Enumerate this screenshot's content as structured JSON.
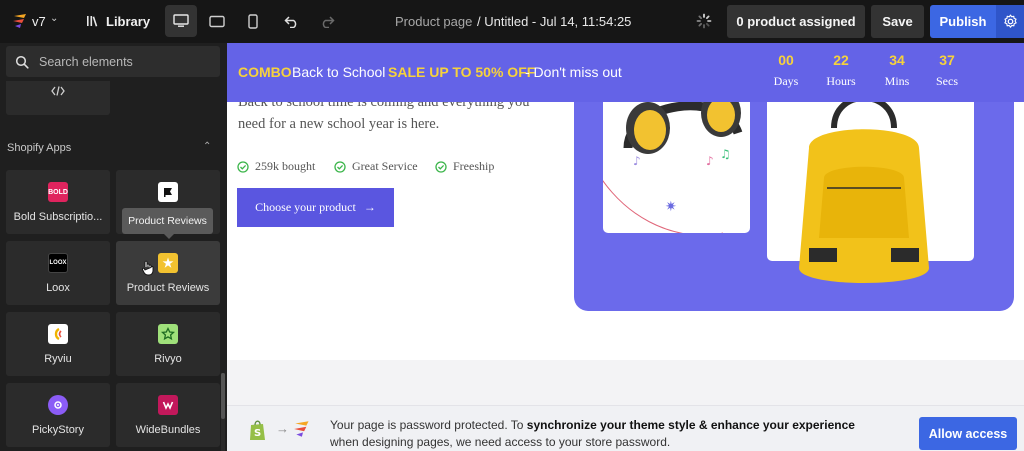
{
  "topbar": {
    "version": "v7",
    "library_label": "Library",
    "page_type": "Product page",
    "page_name": "/ Untitled - Jul 14, 11:54:25",
    "assigned_label": "0 product assigned",
    "save_label": "Save",
    "publish_label": "Publish"
  },
  "sidebar": {
    "search_placeholder": "Search elements",
    "section_title": "Shopify Apps",
    "tooltip": "Product Reviews",
    "apps": [
      {
        "label": "Bold Subscriptio...",
        "icon_text": "BOLD",
        "icon_color": "#e0245e"
      },
      {
        "label": "",
        "icon_text": "",
        "icon_color": "#ffffff"
      },
      {
        "label": "Loox",
        "icon_text": "LOOX",
        "icon_color": "#000000"
      },
      {
        "label": "Product Reviews",
        "icon_text": "★",
        "icon_color": "#f2c230"
      },
      {
        "label": "Ryviu",
        "icon_text": "",
        "icon_color": "#ffffff"
      },
      {
        "label": "Rivyo",
        "icon_text": "",
        "icon_color": "#9fe07a"
      },
      {
        "label": "PickyStory",
        "icon_text": "",
        "icon_color": "#8b5cf6"
      },
      {
        "label": "WideBundles",
        "icon_text": "",
        "icon_color": "#c2185b"
      }
    ]
  },
  "promo": {
    "combo": "COMBO",
    "text": "Back to School",
    "sale": "SALE UP TO 50% OFF",
    "tail": "- Don't miss out",
    "countdown": [
      {
        "value": "00",
        "label": "Days"
      },
      {
        "value": "22",
        "label": "Hours"
      },
      {
        "value": "34",
        "label": "Mins"
      },
      {
        "value": "37",
        "label": "Secs"
      }
    ]
  },
  "hero": {
    "copy": "Back to school time is coming and everything you need for a new school year is here.",
    "features": [
      "259k bought",
      "Great Service",
      "Freeship"
    ],
    "cta": "Choose your product"
  },
  "password_notice": {
    "text_1": "Your page is password protected. To ",
    "text_bold": "synchronize your theme style & enhance your experience",
    "text_2": "when designing pages, we need access to your store password.",
    "button": "Allow access"
  },
  "colors": {
    "accent": "#3c67e3",
    "promo_bg": "#6463e7",
    "promo_highlight": "#f6d23c",
    "cta_bg": "#5a56e0"
  }
}
